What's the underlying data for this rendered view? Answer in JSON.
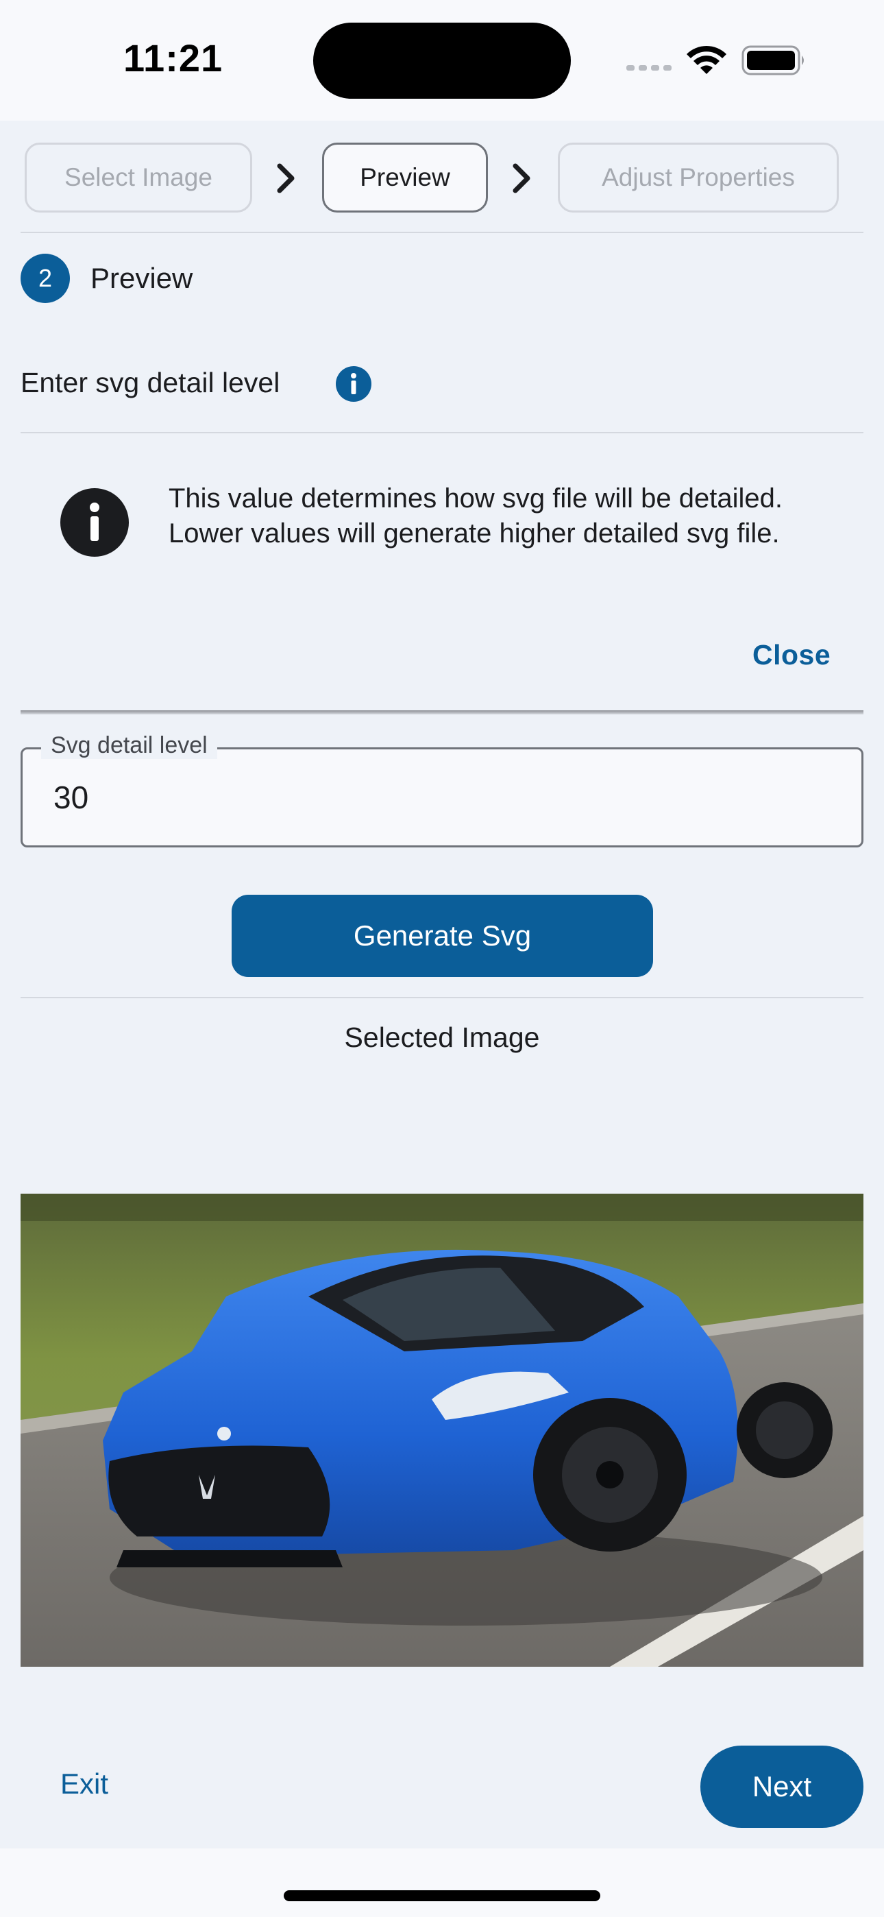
{
  "status_bar": {
    "time": "11:21"
  },
  "stepper": {
    "steps": [
      {
        "label": "Select Image",
        "state": "inactive"
      },
      {
        "label": "Preview",
        "state": "active"
      },
      {
        "label": "Adjust Properties",
        "state": "inactive"
      }
    ]
  },
  "step_header": {
    "number": "2",
    "title": "Preview"
  },
  "detail": {
    "label": "Enter svg detail level"
  },
  "info_banner": {
    "text": "This value determines how svg file will be detailed. Lower values will generate higher detailed svg file.",
    "close_label": "Close"
  },
  "svg_field": {
    "label": "Svg detail level",
    "value": "30"
  },
  "generate_button": {
    "label": "Generate Svg"
  },
  "selected_image": {
    "label": "Selected Image"
  },
  "footer": {
    "exit_label": "Exit",
    "next_label": "Next"
  },
  "colors": {
    "primary": "#0b5e99",
    "background": "#eef2f8",
    "car_body": "#1f63d4"
  },
  "icons": [
    "signal-icon",
    "wifi-icon",
    "battery-icon",
    "chevron-right-icon",
    "info-icon",
    "info-filled-icon"
  ]
}
